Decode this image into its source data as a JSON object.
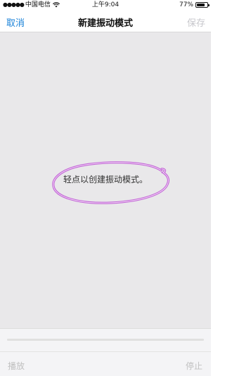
{
  "status_bar": {
    "signal": "●●●●●",
    "carrier": "中国电信",
    "time": "上午9:04",
    "battery_text": "77%",
    "battery_level": 0.77
  },
  "nav": {
    "cancel_label": "取消",
    "title": "新建振动模式",
    "save_label": "保存"
  },
  "canvas": {
    "hint": "轻点以创建振动模式。",
    "annotation_color": "#c266d6"
  },
  "bottom": {
    "play_label": "播放",
    "stop_label": "停止",
    "progress": 0
  }
}
